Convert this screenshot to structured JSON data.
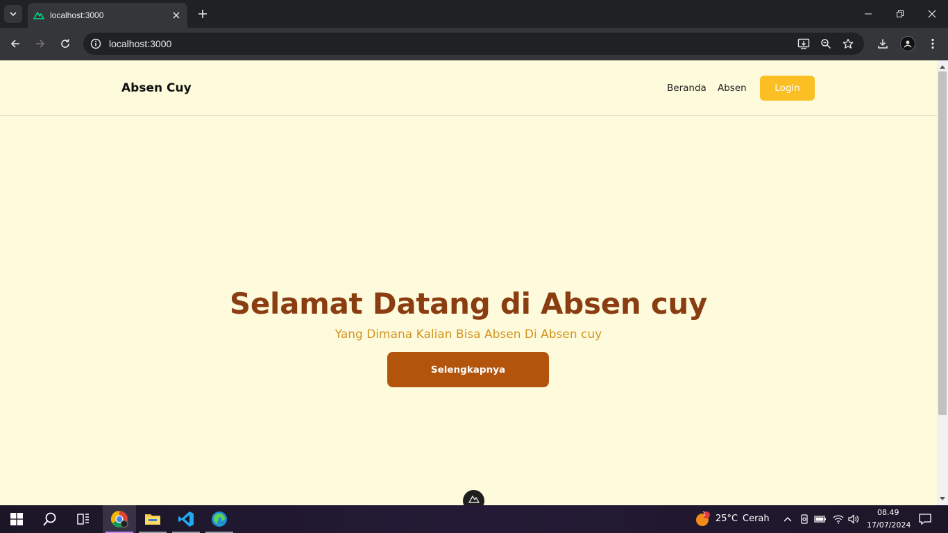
{
  "browser": {
    "tab_title": "localhost:3000",
    "url": "localhost:3000"
  },
  "site": {
    "brand": "Absen Cuy",
    "nav": [
      "Beranda",
      "Absen"
    ],
    "login_label": "Login",
    "hero_title": "Selamat Datang di Absen cuy",
    "hero_subtitle": "Yang Dimana Kalian Bisa Absen Di Absen cuy",
    "hero_button": "Selengkapnya"
  },
  "taskbar": {
    "weather_temp": "25°C",
    "weather_text": "Cerah",
    "weather_badge": "1",
    "time": "08.49",
    "date": "17/07/2024"
  },
  "colors": {
    "page_bg": "#fefbdd",
    "title": "#8b3d12",
    "subtitle": "#d1931e",
    "primary_button": "#b3540d",
    "login_button": "#fbbf24"
  },
  "icons": {
    "favicon": "nuxt-icon",
    "tray": [
      "chevron-up-icon",
      "meet-now-icon",
      "battery-icon",
      "wifi-icon",
      "volume-icon",
      "notification-icon"
    ]
  }
}
